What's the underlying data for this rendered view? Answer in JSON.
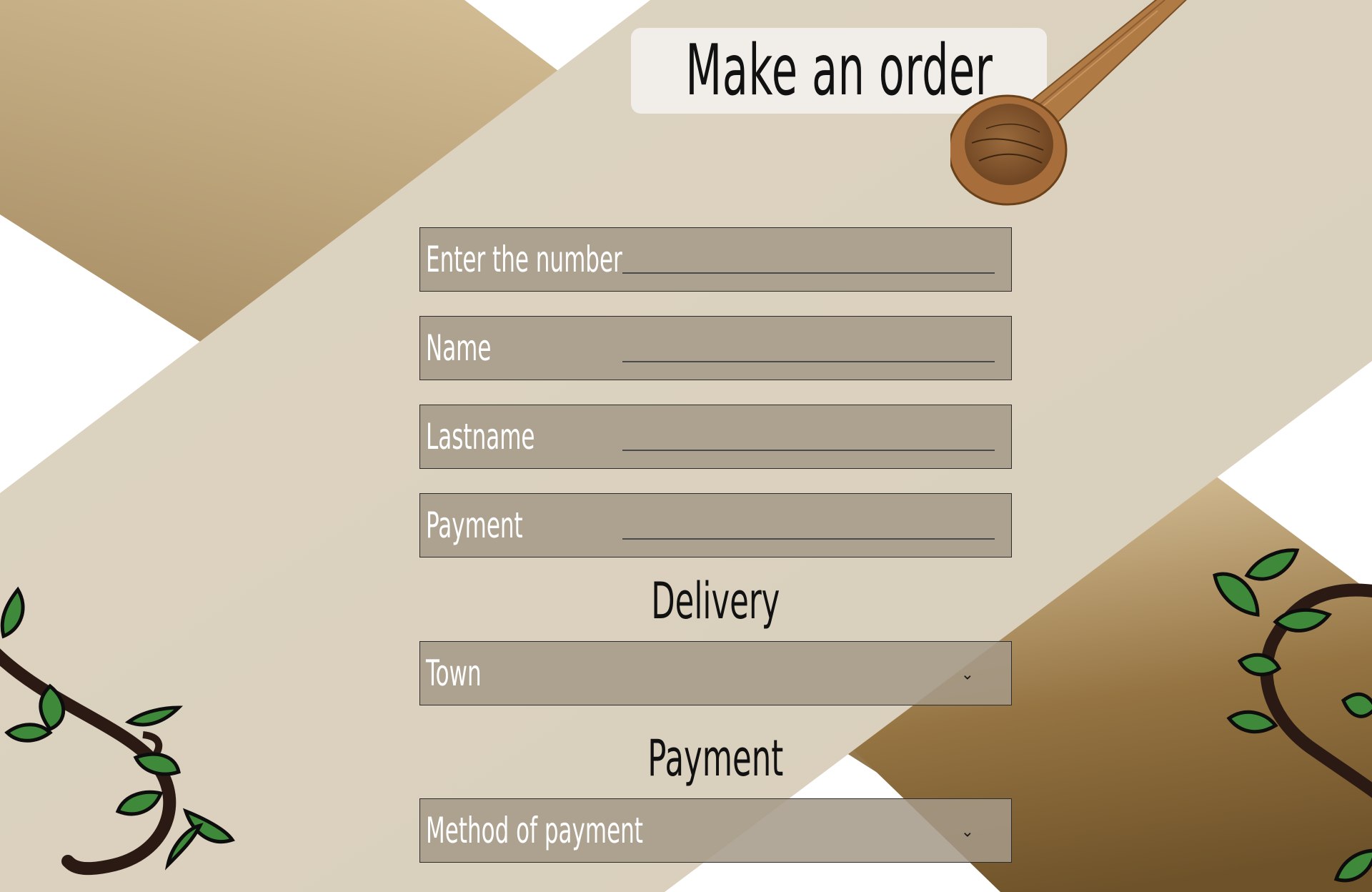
{
  "header": {
    "title": "Make an order"
  },
  "form": {
    "fields": [
      {
        "label": "Enter the number"
      },
      {
        "label": "Name"
      },
      {
        "label": "Lastname"
      },
      {
        "label": "Payment"
      }
    ],
    "delivery": {
      "heading": "Delivery",
      "select_value": "Town"
    },
    "payment": {
      "heading": "Payment",
      "select_value": "Method of payment"
    }
  },
  "icons": {
    "dropdown": "chevron-down-icon",
    "decoration_spoon": "wooden-spoon",
    "decoration_vines": "vine-leaves"
  },
  "colors": {
    "band": "#dcd1be",
    "field_bg": "#ada292",
    "gold_light": "#dec9a1",
    "gold_dark": "#7a5c32",
    "title_bg": "#f1eee9",
    "leaf": "#3f8a3a"
  }
}
